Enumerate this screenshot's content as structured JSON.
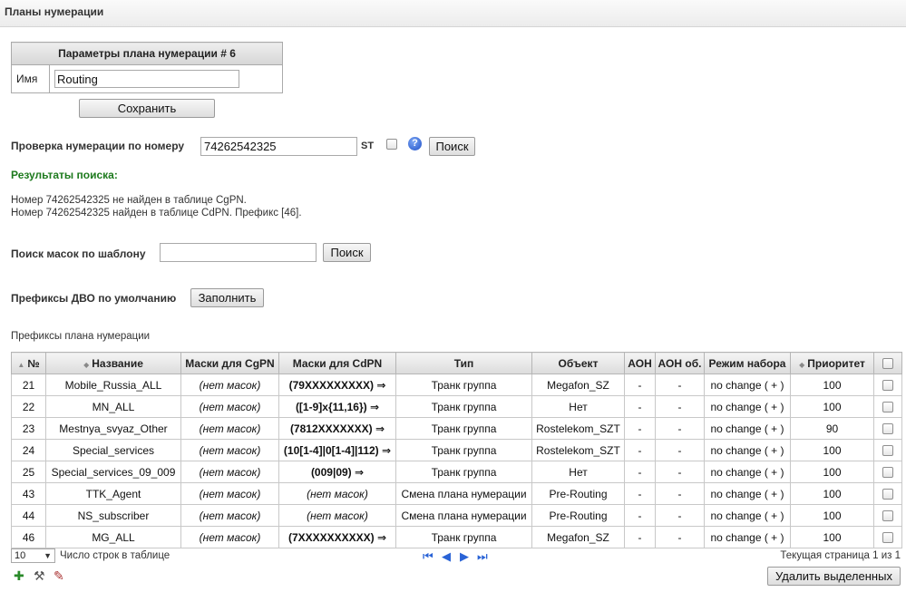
{
  "page_title": "Планы нумерации",
  "params": {
    "header": "Параметры плана нумерации # 6",
    "name_label": "Имя",
    "name_value": "Routing",
    "save_label": "Сохранить"
  },
  "number_check": {
    "label": "Проверка нумерации по номеру",
    "value": "74262542325",
    "st_label": "ST",
    "help_glyph": "?",
    "search_label": "Поиск"
  },
  "results": {
    "title": "Результаты поиска:",
    "lines": [
      "Номер 74262542325 не найден в таблице CgPN.",
      "Номер 74262542325 найден в таблице CdPN. Префикс [46]."
    ]
  },
  "mask_search": {
    "label": "Поиск масок по шаблону",
    "value": "",
    "search_label": "Поиск"
  },
  "vas_prefixes": {
    "label": "Префиксы ДВО по умолчанию",
    "fill_label": "Заполнить"
  },
  "table": {
    "caption": "Префиксы плана нумерации",
    "columns": [
      "№",
      "Название",
      "Маски для CgPN",
      "Маски для CdPN",
      "Тип",
      "Объект",
      "АОН",
      "АОН об.",
      "Режим набора",
      "Приоритет"
    ],
    "rows": [
      {
        "num": "21",
        "name": "Mobile_Russia_ALL",
        "cgpn": "(нет масок)",
        "cdpn": "(79XXXXXXXXX) ⇒",
        "type": "Транк группа",
        "object": "Megafon_SZ",
        "aon": "-",
        "aon_ob": "-",
        "dial": "no change ( + )",
        "prio": "100"
      },
      {
        "num": "22",
        "name": "MN_ALL",
        "cgpn": "(нет масок)",
        "cdpn": "([1-9]x{11,16}) ⇒",
        "type": "Транк группа",
        "object": "Нет",
        "aon": "-",
        "aon_ob": "-",
        "dial": "no change ( + )",
        "prio": "100"
      },
      {
        "num": "23",
        "name": "Mestnya_svyaz_Other",
        "cgpn": "(нет масок)",
        "cdpn": "(7812XXXXXXX) ⇒",
        "type": "Транк группа",
        "object": "Rostelekom_SZT",
        "aon": "-",
        "aon_ob": "-",
        "dial": "no change ( + )",
        "prio": "90"
      },
      {
        "num": "24",
        "name": "Special_services",
        "cgpn": "(нет масок)",
        "cdpn": "(10[1-4]|0[1-4]|112) ⇒",
        "type": "Транк группа",
        "object": "Rostelekom_SZT",
        "aon": "-",
        "aon_ob": "-",
        "dial": "no change ( + )",
        "prio": "100"
      },
      {
        "num": "25",
        "name": "Special_services_09_009",
        "cgpn": "(нет масок)",
        "cdpn": "(009|09) ⇒",
        "type": "Транк группа",
        "object": "Нет",
        "aon": "-",
        "aon_ob": "-",
        "dial": "no change ( + )",
        "prio": "100"
      },
      {
        "num": "43",
        "name": "TTK_Agent",
        "cgpn": "(нет масок)",
        "cdpn": "(нет масок)",
        "type": "Смена плана нумерации",
        "object": "Pre-Routing",
        "aon": "-",
        "aon_ob": "-",
        "dial": "no change ( + )",
        "prio": "100"
      },
      {
        "num": "44",
        "name": "NS_subscriber",
        "cgpn": "(нет масок)",
        "cdpn": "(нет масок)",
        "type": "Смена плана нумерации",
        "object": "Pre-Routing",
        "aon": "-",
        "aon_ob": "-",
        "dial": "no change ( + )",
        "prio": "100"
      },
      {
        "num": "46",
        "name": "MG_ALL",
        "cgpn": "(нет масок)",
        "cdpn": "(7XXXXXXXXXX) ⇒",
        "type": "Транк группа",
        "object": "Megafon_SZ",
        "aon": "-",
        "aon_ob": "-",
        "dial": "no change ( + )",
        "prio": "100"
      }
    ]
  },
  "footer": {
    "rows_per_page": "10",
    "rows_per_page_label": "Число строк в таблице",
    "page_info": "Текущая страница 1 из 1",
    "delete_selected_label": "Удалить выделенных",
    "nav_icons": [
      "first-page-icon",
      "prev-page-icon",
      "next-page-icon",
      "last-page-icon"
    ],
    "tool_icons": [
      "add-icon",
      "tools-icon",
      "edit-icon"
    ]
  },
  "colors": {
    "results_title": "#1d7a1d",
    "nav_icons": "#2a63d6"
  }
}
